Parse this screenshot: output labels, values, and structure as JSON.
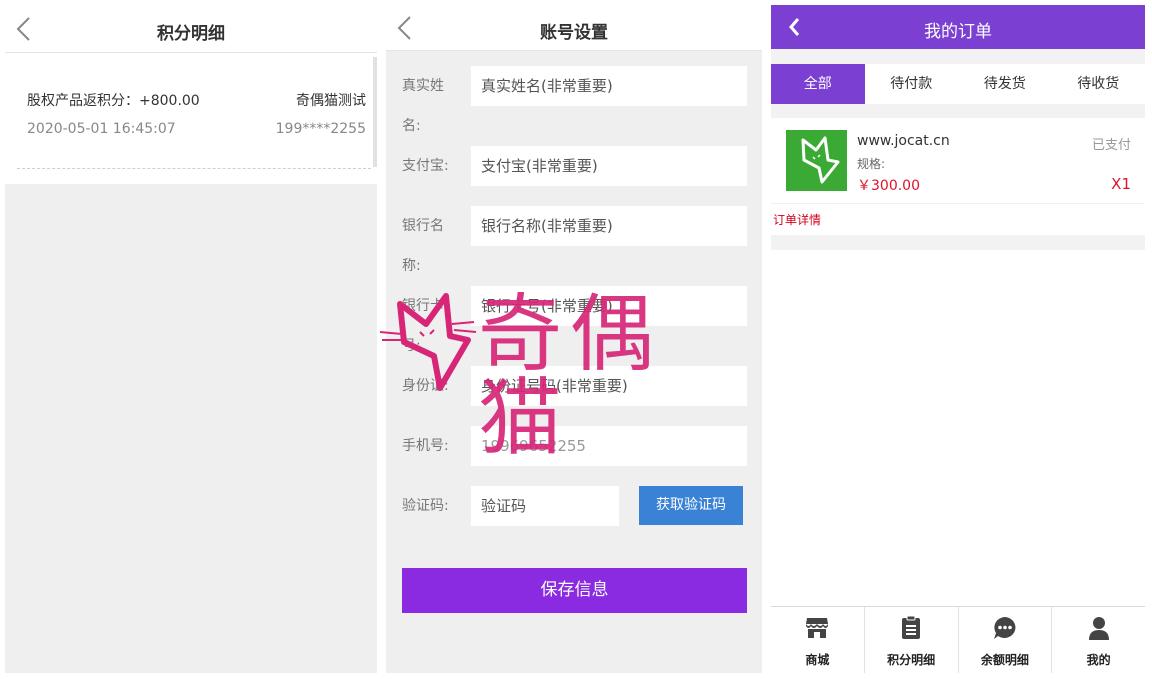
{
  "points": {
    "title": "积分明细",
    "record": {
      "description": "股权产品返积分：+800.00",
      "user": "奇偶猫测试",
      "time": "2020-05-01 16:45:07",
      "phone": "199****2255"
    }
  },
  "account": {
    "title": "账号设置",
    "fields": [
      {
        "label": "真实姓名:",
        "placeholder": "真实姓名(非常重要)"
      },
      {
        "label": "支付宝:",
        "placeholder": "支付宝(非常重要)"
      },
      {
        "label": "银行名称:",
        "placeholder": "银行名称(非常重要)"
      },
      {
        "label": "银行卡号:",
        "placeholder": "银行卡号(非常重要)"
      },
      {
        "label": "身份证:",
        "placeholder": "身份证号码(非常重要)"
      },
      {
        "label": "手机号:",
        "placeholder": "19969652255"
      },
      {
        "label": "验证码:",
        "placeholder": "验证码"
      }
    ],
    "get_code_label": "获取验证码",
    "save_label": "保存信息"
  },
  "orders": {
    "title": "我的订单",
    "tabs": [
      "全部",
      "待付款",
      "待发货",
      "待收货"
    ],
    "active_tab": "全部",
    "order": {
      "name": "www.jocat.cn",
      "status": "已支付",
      "spec": "规格:",
      "price": "￥300.00",
      "qty": "X1",
      "detail_link": "订单详情"
    },
    "tabbar": [
      {
        "label": "商城",
        "icon": "store-icon"
      },
      {
        "label": "积分明细",
        "icon": "clipboard-icon"
      },
      {
        "label": "余额明细",
        "icon": "chat-bubble-icon"
      },
      {
        "label": "我的",
        "icon": "user-icon"
      }
    ]
  },
  "watermark": {
    "text": "奇偶猫"
  },
  "colors": {
    "brand_purple": "#7b3fd2",
    "save_purple": "#8a2be2",
    "code_blue": "#3a82d6",
    "price_red": "#e0132a",
    "watermark_pink": "#d72678",
    "thumb_green": "#3aaa35"
  }
}
